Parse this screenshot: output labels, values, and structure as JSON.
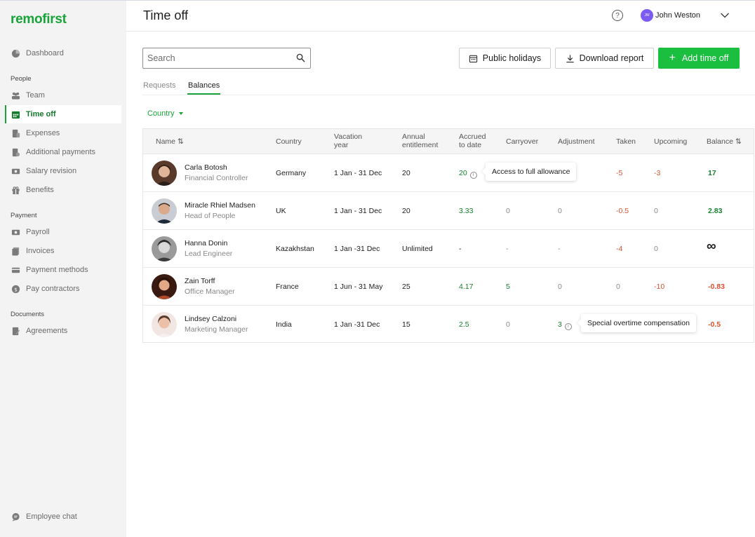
{
  "app": {
    "logo": "remofirst",
    "page_title": "Time off"
  },
  "header": {
    "help_label": "?",
    "user_initials": "JW",
    "user_name": "John Weston"
  },
  "sidebar": {
    "dashboard": "Dashboard",
    "sections": {
      "people": "People",
      "payment": "Payment",
      "documents": "Documents"
    },
    "items": {
      "team": "Team",
      "time_off": "Time off",
      "expenses": "Expenses",
      "additional_payments": "Additional payments",
      "salary_revision": "Salary revision",
      "benefits": "Benefits",
      "payroll": "Payroll",
      "invoices": "Invoices",
      "payment_methods": "Payment methods",
      "pay_contractors": "Pay contractors",
      "agreements": "Agreements"
    },
    "employee_chat": "Employee chat"
  },
  "toolbar": {
    "search_placeholder": "Search",
    "public_holidays": "Public holidays",
    "download_report": "Download report",
    "add_time_off": "Add time off"
  },
  "tabs": {
    "requests": "Requests",
    "balances": "Balances"
  },
  "filter": {
    "country": "Country"
  },
  "table": {
    "headers": {
      "name": "Name ⇅",
      "country": "Country",
      "vacation_year_1": "Vacation",
      "vacation_year_2": "year",
      "annual_1": "Annual",
      "annual_2": "entitlement",
      "accrued_1": "Accrued",
      "accrued_2": "to date",
      "carryover": "Carryover",
      "adjustment": "Adjustment",
      "taken": "Taken",
      "upcoming": "Upcoming",
      "balance": "Balance ⇅"
    },
    "rows": [
      {
        "name": "Carla Botosh",
        "role": "Financial Controller",
        "country": "Germany",
        "vacation_year": "1 Jan - 31 Dec",
        "annual": "20",
        "accrued": "20",
        "carryover": "",
        "adjustment": "",
        "taken": "-5",
        "upcoming": "-3",
        "balance": "17"
      },
      {
        "name": "Miracle Rhiel Madsen",
        "role": "Head of People",
        "country": "UK",
        "vacation_year": "1 Jan - 31 Dec",
        "annual": "20",
        "accrued": "3.33",
        "carryover": "0",
        "adjustment": "0",
        "taken": "-0.5",
        "upcoming": "0",
        "balance": "2.83"
      },
      {
        "name": "Hanna Donin",
        "role": "Lead Engineer",
        "country": "Kazakhstan",
        "vacation_year": "1 Jan -31 Dec",
        "annual": "Unlimited",
        "accrued": "-",
        "carryover": "-",
        "adjustment": "-",
        "taken": "-4",
        "upcoming": "0",
        "balance": "∞"
      },
      {
        "name": "Zain Torff",
        "role": "Office Manager",
        "country": "France",
        "vacation_year": "1 Jun - 31 May",
        "annual": "25",
        "accrued": "4.17",
        "carryover": "5",
        "adjustment": "0",
        "taken": "0",
        "upcoming": "-10",
        "balance": "-0.83"
      },
      {
        "name": "Lindsey Calzoni",
        "role": "Marketing Manager",
        "country": "India",
        "vacation_year": "1 Jan -31 Dec",
        "annual": "15",
        "accrued": "2.5",
        "carryover": "0",
        "adjustment": "3",
        "taken": "",
        "upcoming": "",
        "balance": "-0.5"
      }
    ],
    "tooltips": {
      "accrued_row1": "Access to full allowance",
      "adjustment_row5": "Special overtime compensation"
    },
    "info_icon": "i"
  },
  "colors": {
    "brand": "#19a33a",
    "primary_button": "#1bbf40",
    "positive": "#16802f",
    "negative": "#e0512e",
    "avatar_user": "#7b5bf2"
  }
}
